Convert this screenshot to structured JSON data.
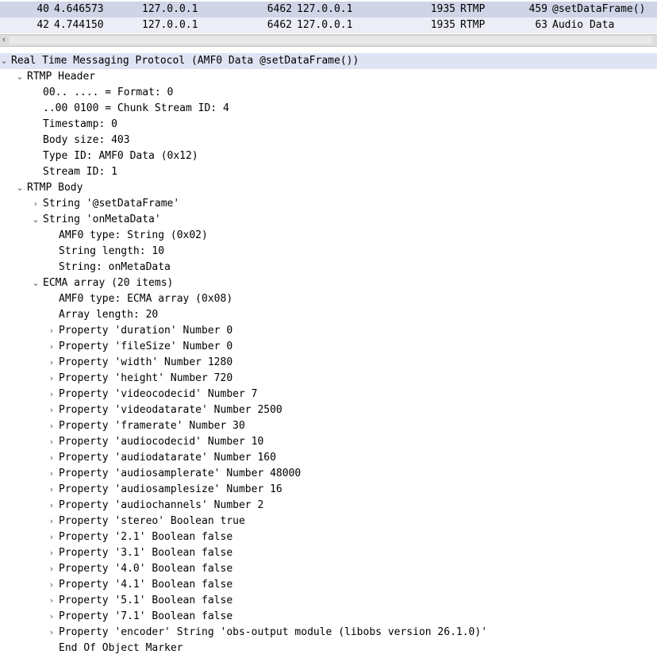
{
  "packets": [
    {
      "no": "40",
      "time": "4.646573",
      "src": "127.0.0.1",
      "sport": "6462",
      "dst": "127.0.0.1",
      "dport": "1935",
      "proto": "RTMP",
      "len": "459",
      "info": "@setDataFrame()"
    },
    {
      "no": "42",
      "time": "4.744150",
      "src": "127.0.0.1",
      "sport": "6462",
      "dst": "127.0.0.1",
      "dport": "1935",
      "proto": "RTMP",
      "len": "63",
      "info": "Audio Data"
    }
  ],
  "tree": [
    {
      "level": 0,
      "toggle": "expanded",
      "text": "Real Time Messaging Protocol (AMF0 Data @setDataFrame())"
    },
    {
      "level": 1,
      "toggle": "expanded",
      "text": "RTMP Header"
    },
    {
      "level": 2,
      "toggle": "none",
      "text": "00.. .... = Format: 0"
    },
    {
      "level": 2,
      "toggle": "none",
      "text": "..00 0100 = Chunk Stream ID: 4"
    },
    {
      "level": 2,
      "toggle": "none",
      "text": "Timestamp: 0"
    },
    {
      "level": 2,
      "toggle": "none",
      "text": "Body size: 403"
    },
    {
      "level": 2,
      "toggle": "none",
      "text": "Type ID: AMF0 Data (0x12)"
    },
    {
      "level": 2,
      "toggle": "none",
      "text": "Stream ID: 1"
    },
    {
      "level": 1,
      "toggle": "expanded",
      "text": "RTMP Body"
    },
    {
      "level": 2,
      "toggle": "collapsed",
      "text": "String '@setDataFrame'"
    },
    {
      "level": 2,
      "toggle": "expanded",
      "text": "String 'onMetaData'"
    },
    {
      "level": 3,
      "toggle": "none",
      "text": "AMF0 type: String (0x02)"
    },
    {
      "level": 3,
      "toggle": "none",
      "text": "String length: 10"
    },
    {
      "level": 3,
      "toggle": "none",
      "text": "String: onMetaData"
    },
    {
      "level": 2,
      "toggle": "expanded",
      "text": "ECMA array (20 items)"
    },
    {
      "level": 3,
      "toggle": "none",
      "text": "AMF0 type: ECMA array (0x08)"
    },
    {
      "level": 3,
      "toggle": "none",
      "text": "Array length: 20"
    },
    {
      "level": 3,
      "toggle": "collapsed",
      "text": "Property 'duration' Number 0"
    },
    {
      "level": 3,
      "toggle": "collapsed",
      "text": "Property 'fileSize' Number 0"
    },
    {
      "level": 3,
      "toggle": "collapsed",
      "text": "Property 'width' Number 1280"
    },
    {
      "level": 3,
      "toggle": "collapsed",
      "text": "Property 'height' Number 720"
    },
    {
      "level": 3,
      "toggle": "collapsed",
      "text": "Property 'videocodecid' Number 7"
    },
    {
      "level": 3,
      "toggle": "collapsed",
      "text": "Property 'videodatarate' Number 2500"
    },
    {
      "level": 3,
      "toggle": "collapsed",
      "text": "Property 'framerate' Number 30"
    },
    {
      "level": 3,
      "toggle": "collapsed",
      "text": "Property 'audiocodecid' Number 10"
    },
    {
      "level": 3,
      "toggle": "collapsed",
      "text": "Property 'audiodatarate' Number 160"
    },
    {
      "level": 3,
      "toggle": "collapsed",
      "text": "Property 'audiosamplerate' Number 48000"
    },
    {
      "level": 3,
      "toggle": "collapsed",
      "text": "Property 'audiosamplesize' Number 16"
    },
    {
      "level": 3,
      "toggle": "collapsed",
      "text": "Property 'audiochannels' Number 2"
    },
    {
      "level": 3,
      "toggle": "collapsed",
      "text": "Property 'stereo' Boolean true"
    },
    {
      "level": 3,
      "toggle": "collapsed",
      "text": "Property '2.1' Boolean false"
    },
    {
      "level": 3,
      "toggle": "collapsed",
      "text": "Property '3.1' Boolean false"
    },
    {
      "level": 3,
      "toggle": "collapsed",
      "text": "Property '4.0' Boolean false"
    },
    {
      "level": 3,
      "toggle": "collapsed",
      "text": "Property '4.1' Boolean false"
    },
    {
      "level": 3,
      "toggle": "collapsed",
      "text": "Property '5.1' Boolean false"
    },
    {
      "level": 3,
      "toggle": "collapsed",
      "text": "Property '7.1' Boolean false"
    },
    {
      "level": 3,
      "toggle": "collapsed",
      "text": "Property 'encoder' String 'obs-output module (libobs version 26.1.0)'"
    },
    {
      "level": 3,
      "toggle": "none",
      "text": "End Of Object Marker"
    }
  ]
}
